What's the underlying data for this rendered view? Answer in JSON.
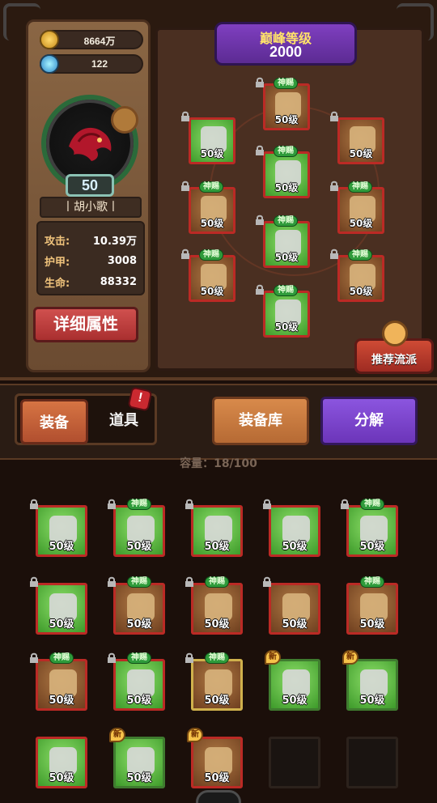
{
  "top": {
    "resources": {
      "gold": "8664万",
      "gems": "122"
    },
    "player": {
      "level": "50",
      "name": "丨胡小歌丨"
    },
    "stats": [
      {
        "key": "攻击:",
        "value": "10.39万"
      },
      {
        "key": "护甲:",
        "value": "3008"
      },
      {
        "key": "生命:",
        "value": "88332"
      }
    ],
    "buttons": {
      "detail": "详细属性",
      "recommend": "推荐流派"
    },
    "peak": {
      "title": "巅峰等级",
      "value": "2000"
    },
    "equip_slots": [
      {
        "badge": "神赐",
        "level": "50级",
        "rarity": "brown"
      },
      {
        "badge": "",
        "level": "50级",
        "rarity": "green"
      },
      {
        "badge": "",
        "level": "50级",
        "rarity": "brown"
      },
      {
        "badge": "神赐",
        "level": "50级",
        "rarity": "green"
      },
      {
        "badge": "神赐",
        "level": "50级",
        "rarity": "brown"
      },
      {
        "badge": "神赐",
        "level": "50级",
        "rarity": "brown"
      },
      {
        "badge": "神赐",
        "level": "50级",
        "rarity": "green"
      },
      {
        "badge": "神赐",
        "level": "50级",
        "rarity": "brown"
      },
      {
        "badge": "神赐",
        "level": "50级",
        "rarity": "brown"
      },
      {
        "badge": "神赐",
        "level": "50级",
        "rarity": "green"
      }
    ]
  },
  "tabs": {
    "equip": "装备",
    "items": "道具",
    "items_notice": "!",
    "warehouse": "装备库",
    "decompose": "分解"
  },
  "inventory": {
    "capacity_label": "容量：",
    "capacity_value": "18/100",
    "items": [
      {
        "badge": "",
        "level": "50级",
        "rarity": "green",
        "locked": true,
        "new": false
      },
      {
        "badge": "神赐",
        "level": "50级",
        "rarity": "green",
        "locked": true,
        "new": false
      },
      {
        "badge": "",
        "level": "50级",
        "rarity": "green",
        "locked": true,
        "new": false
      },
      {
        "badge": "",
        "level": "50级",
        "rarity": "green",
        "locked": true,
        "new": false
      },
      {
        "badge": "神赐",
        "level": "50级",
        "rarity": "green",
        "locked": true,
        "new": false
      },
      {
        "badge": "",
        "level": "50级",
        "rarity": "green",
        "locked": true,
        "new": false
      },
      {
        "badge": "神赐",
        "level": "50级",
        "rarity": "brown",
        "locked": true,
        "new": false
      },
      {
        "badge": "神赐",
        "level": "50级",
        "rarity": "brown",
        "locked": true,
        "new": false
      },
      {
        "badge": "",
        "level": "50级",
        "rarity": "brown",
        "locked": true,
        "new": false
      },
      {
        "badge": "神赐",
        "level": "50级",
        "rarity": "brown",
        "locked": false,
        "new": false
      },
      {
        "badge": "神赐",
        "level": "50级",
        "rarity": "brown",
        "locked": true,
        "new": false
      },
      {
        "badge": "神赐",
        "level": "50级",
        "rarity": "green",
        "locked": true,
        "new": false
      },
      {
        "badge": "神赐",
        "level": "50级",
        "rarity": "brown",
        "locked": true,
        "new": false
      },
      {
        "badge": "",
        "level": "50级",
        "rarity": "green",
        "locked": false,
        "new": true,
        "new_label": "新"
      },
      {
        "badge": "",
        "level": "50级",
        "rarity": "green",
        "locked": false,
        "new": true,
        "new_label": "新"
      },
      {
        "badge": "",
        "level": "50级",
        "rarity": "green",
        "locked": false,
        "new": false
      },
      {
        "badge": "",
        "level": "50级",
        "rarity": "green",
        "locked": false,
        "new": true,
        "new_label": "新"
      },
      {
        "badge": "",
        "level": "50级",
        "rarity": "brown",
        "locked": false,
        "new": true,
        "new_label": "新"
      }
    ]
  }
}
